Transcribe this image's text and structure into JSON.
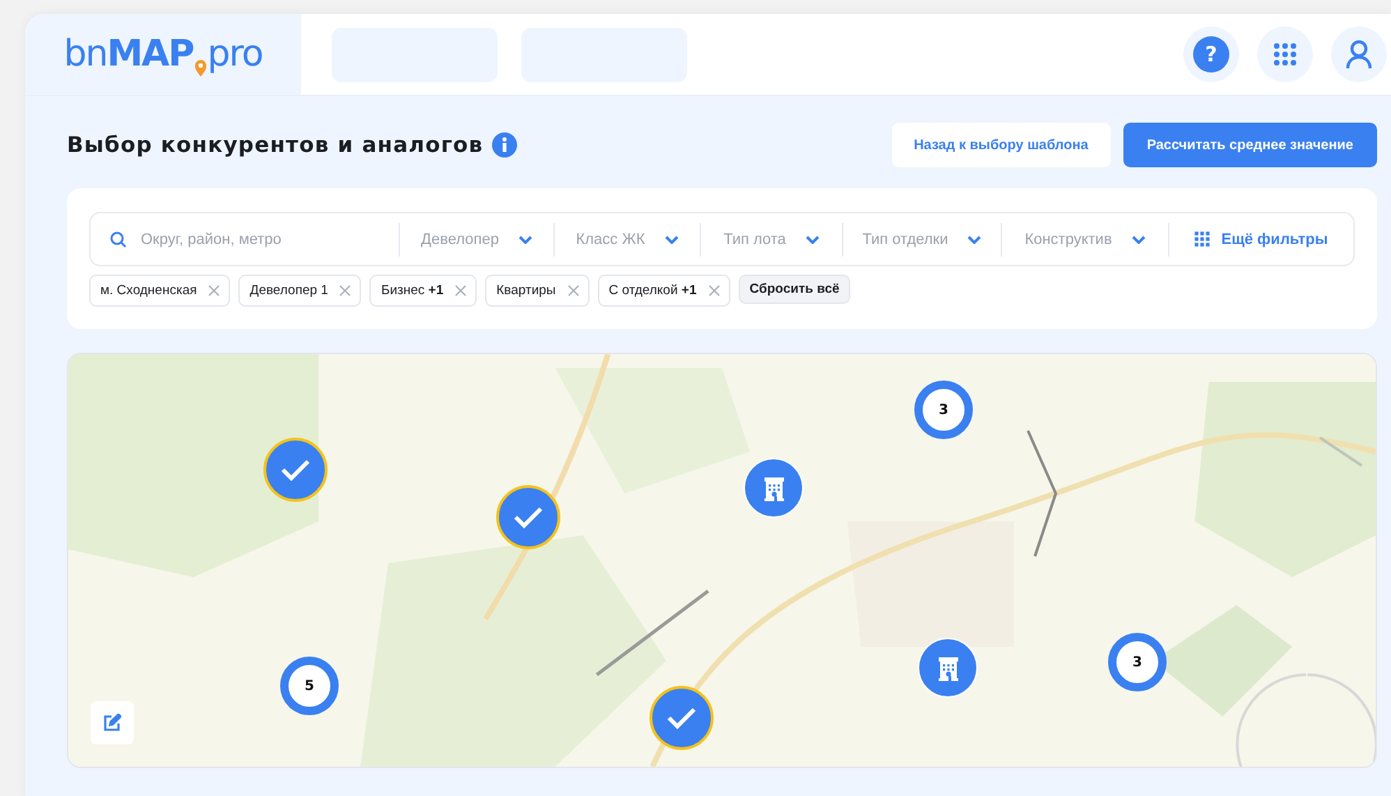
{
  "header": {
    "logo": {
      "prefix": "bn",
      "brand": "MAP",
      "suffix": "pro"
    },
    "help": "?"
  },
  "page": {
    "title": "Выбор конкурентов и аналогов",
    "buttons": [
      {
        "label": "Назад к выбору шаблона",
        "kind": "secondary"
      },
      {
        "label": "Рассчитать среднее значение",
        "kind": "primary"
      }
    ]
  },
  "filters": {
    "search": {
      "placeholder": "Округ, район, метро"
    },
    "dropdowns": [
      "Девелопер",
      "Класс ЖК",
      "Тип лота",
      "Тип отделки",
      "Конструктив"
    ],
    "more": "Ещё фильтры",
    "chips": [
      "м. Сходненская",
      "Девелопер 1",
      "Бизнес **+1**",
      "Квартиры",
      "С отделкой **+1**"
    ],
    "reset": "Сбросить всё"
  },
  "map": {
    "markers": [
      {
        "kind": "selected"
      },
      {
        "kind": "selected"
      },
      {
        "kind": "selected"
      },
      {
        "kind": "cluster",
        "count": "5"
      },
      {
        "kind": "cluster",
        "count": "3"
      },
      {
        "kind": "cluster",
        "count": "3"
      },
      {
        "kind": "building"
      },
      {
        "kind": "building"
      }
    ]
  }
}
